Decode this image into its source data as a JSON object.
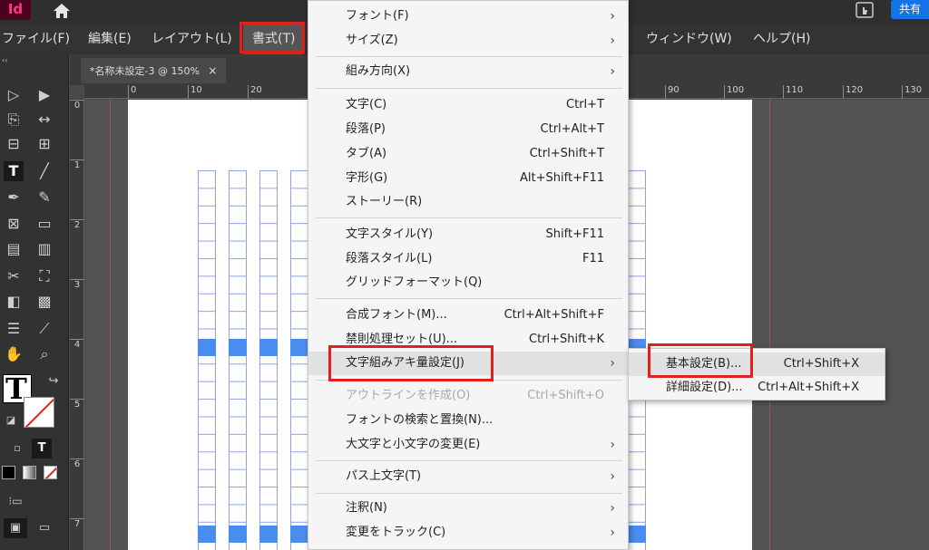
{
  "app": {
    "logo": "Id",
    "share_label": "共有"
  },
  "menubar": {
    "items": [
      "ファイル(F)",
      "編集(E)",
      "レイアウト(L)",
      "書式(T)",
      "ウィンドウ(W)",
      "ヘルプ(H)"
    ]
  },
  "document": {
    "tab_title": "*名称未設定-3 @ 150%",
    "close_glyph": "×"
  },
  "ruler": {
    "h_labels": [
      "0",
      "10",
      "20",
      "90",
      "100",
      "110",
      "120",
      "130"
    ],
    "v_labels": [
      "0",
      "1",
      "2",
      "3",
      "4",
      "5",
      "6",
      "7"
    ]
  },
  "format_menu": {
    "items": [
      {
        "label": "フォント(F)",
        "shortcut": "",
        "submenu": true
      },
      {
        "label": "サイズ(Z)",
        "shortcut": "",
        "submenu": true
      },
      {
        "label": "組み方向(X)",
        "shortcut": "",
        "submenu": true
      },
      {
        "label": "文字(C)",
        "shortcut": "Ctrl+T",
        "submenu": false
      },
      {
        "label": "段落(P)",
        "shortcut": "Ctrl+Alt+T",
        "submenu": false
      },
      {
        "label": "タブ(A)",
        "shortcut": "Ctrl+Shift+T",
        "submenu": false
      },
      {
        "label": "字形(G)",
        "shortcut": "Alt+Shift+F11",
        "submenu": false
      },
      {
        "label": "ストーリー(R)",
        "shortcut": "",
        "submenu": false
      },
      {
        "label": "文字スタイル(Y)",
        "shortcut": "Shift+F11",
        "submenu": false
      },
      {
        "label": "段落スタイル(L)",
        "shortcut": "F11",
        "submenu": false
      },
      {
        "label": "グリッドフォーマット(Q)",
        "shortcut": "",
        "submenu": false
      },
      {
        "label": "合成フォント(M)...",
        "shortcut": "Ctrl+Alt+Shift+F",
        "submenu": false
      },
      {
        "label": "禁則処理セット(U)...",
        "shortcut": "Ctrl+Shift+K",
        "submenu": false
      },
      {
        "label": "文字組みアキ量設定(J)",
        "shortcut": "",
        "submenu": true
      },
      {
        "label": "アウトラインを作成(O)",
        "shortcut": "Ctrl+Shift+O",
        "submenu": false
      },
      {
        "label": "フォントの検索と置換(N)...",
        "shortcut": "",
        "submenu": false
      },
      {
        "label": "大文字と小文字の変更(E)",
        "shortcut": "",
        "submenu": true
      },
      {
        "label": "パス上文字(T)",
        "shortcut": "",
        "submenu": true
      },
      {
        "label": "注釈(N)",
        "shortcut": "",
        "submenu": true
      },
      {
        "label": "変更をトラック(C)",
        "shortcut": "",
        "submenu": true
      }
    ]
  },
  "mojikumi_submenu": {
    "items": [
      {
        "label": "基本設定(B)...",
        "shortcut": "Ctrl+Shift+X"
      },
      {
        "label": "詳細設定(D)...",
        "shortcut": "Ctrl+Alt+Shift+X"
      }
    ]
  },
  "colors": {
    "highlight_box": "#e0201b",
    "share_button": "#1473e6",
    "grid_line": "#8fa3e6",
    "grid_fill": "#4a8df0"
  }
}
